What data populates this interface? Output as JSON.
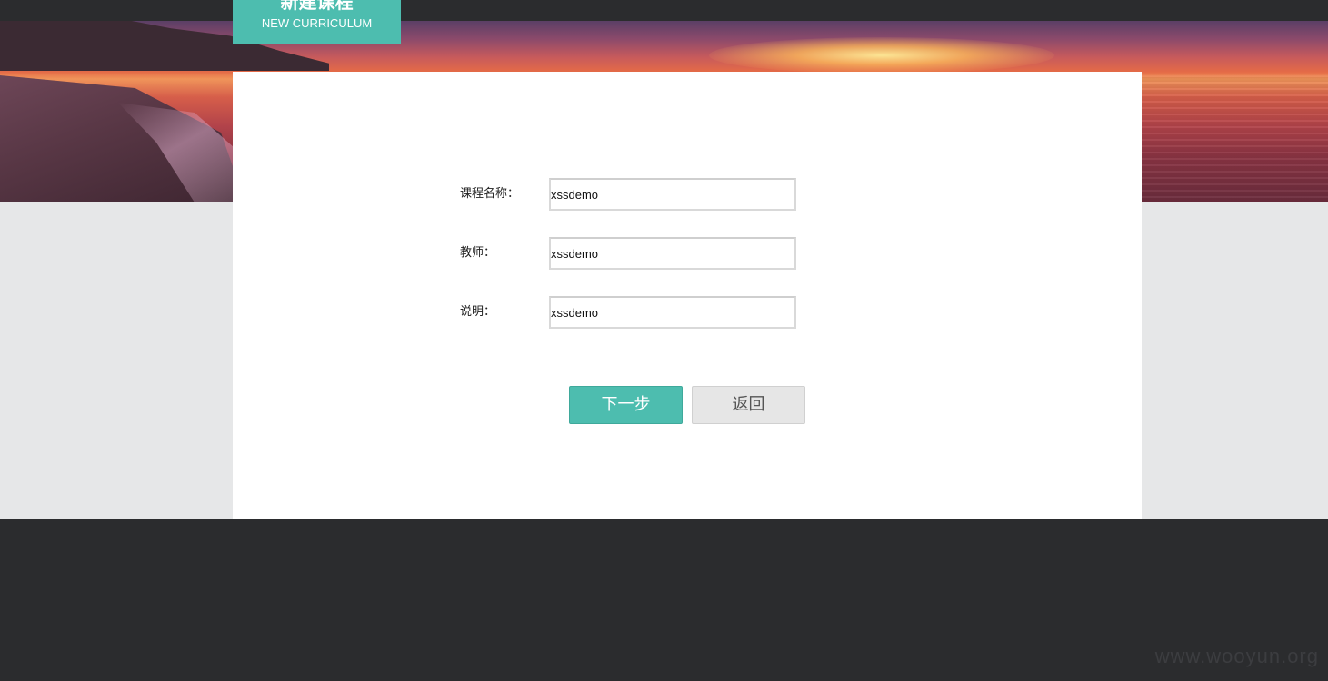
{
  "header": {
    "title_cn": "新建课程",
    "title_en": "NEW CURRICULUM"
  },
  "form": {
    "course_name": {
      "label": "课程名称：",
      "value": "xssdemo"
    },
    "teacher": {
      "label": "教师：",
      "value": "xssdemo"
    },
    "description": {
      "label": "说明：",
      "value": "xssdemo"
    }
  },
  "actions": {
    "next_label": "下一步",
    "back_label": "返回"
  },
  "watermark": "www.wooyun.org",
  "colors": {
    "accent": "#4dbdaf",
    "dark_bg": "#2b2c2e",
    "light_bg": "#e6e7e8",
    "panel_bg": "#ffffff"
  }
}
